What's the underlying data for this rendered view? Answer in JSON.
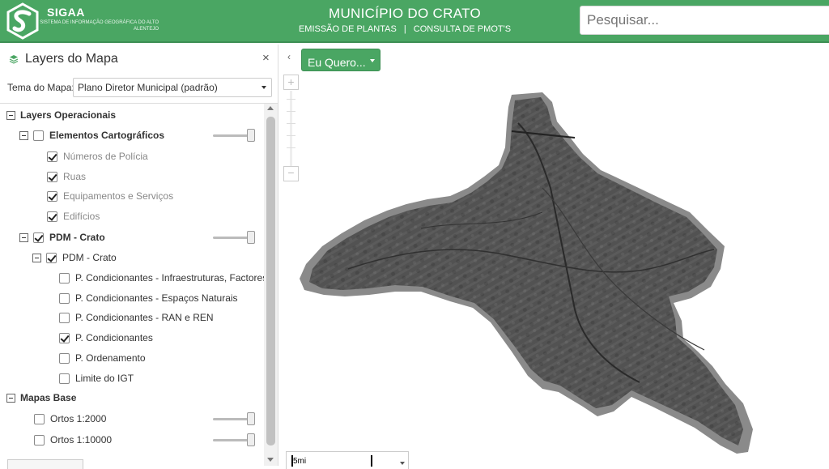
{
  "header": {
    "logo_name": "SIGAA",
    "logo_subtitle": "SISTEMA DE INFORMAÇÃO GEOGRÁFICA DO ALTO ALENTEJO",
    "title": "MUNICÍPIO DO CRATO",
    "links": [
      "EMISSÃO DE PLANTAS",
      "CONSULTA DE PMOT'S"
    ],
    "separator": "|",
    "search_placeholder": "Pesquisar...",
    "brand_color": "#4aa663"
  },
  "panel": {
    "title": "Layers do Mapa",
    "close_icon": "×",
    "theme_label": "Tema do Mapa:",
    "theme_value": "Plano Diretor Municipal (padrão)",
    "tree": {
      "group_operacionais": "Layers Operacionais",
      "elementos": "Elementos Cartográficos",
      "numeros": "Números de Polícia",
      "ruas": "Ruas",
      "equipamentos": "Equipamentos e Serviços",
      "edificios": "Edifícios",
      "pdm_parent": "PDM - Crato",
      "pdm_child": "PDM - Crato",
      "infra": "P. Condicionantes - Infraestruturas, Factores",
      "naturais": "P. Condicionantes - Espaços Naturais",
      "ran": "P. Condicionantes - RAN e REN",
      "condicionantes": "P. Condicionantes",
      "ordenamento": "P. Ordenamento",
      "limite": "Limite do IGT",
      "group_base": "Mapas Base",
      "ortos2000": "Ortos 1:2000",
      "ortos10000": "Ortos 1:10000"
    },
    "slider_levels": {
      "elementos": 1.0,
      "pdm": 1.0,
      "ortos2000": 1.0,
      "ortos10000": 1.0
    }
  },
  "map": {
    "collapse_icon": "‹",
    "eu_quero_label": "Eu Quero...",
    "zoom_in": "+",
    "zoom_out": "−",
    "scale_label": "5mi"
  }
}
